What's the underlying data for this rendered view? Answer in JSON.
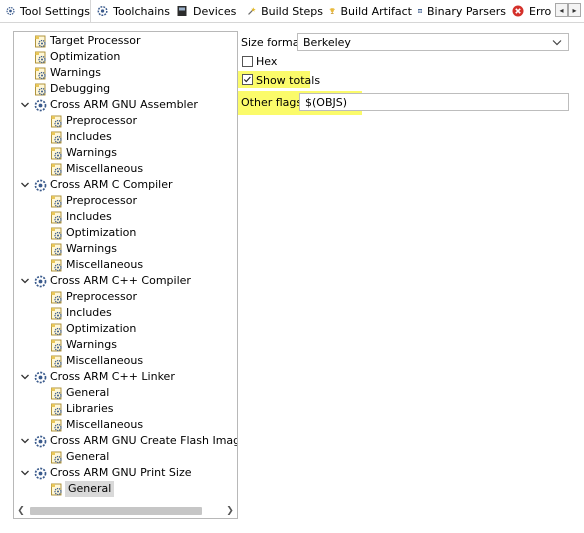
{
  "tabs": [
    {
      "label": "Tool Settings",
      "icon": "gear-settings-icon",
      "active": true
    },
    {
      "label": "Toolchains",
      "icon": "gear-settings-icon"
    },
    {
      "label": "Devices",
      "icon": "device-chip-icon"
    },
    {
      "label": "Build Steps",
      "icon": "build-wand-icon"
    },
    {
      "label": "Build Artifact",
      "icon": "artifact-trophy-icon"
    },
    {
      "label": "Binary Parsers",
      "icon": "binary-parser-icon"
    },
    {
      "label": "Erro",
      "icon": "error-icon"
    }
  ],
  "tree": [
    {
      "label": "Target Processor",
      "level": 1,
      "icon": "settings-page-icon"
    },
    {
      "label": "Optimization",
      "level": 1,
      "icon": "settings-page-icon"
    },
    {
      "label": "Warnings",
      "level": 1,
      "icon": "settings-page-icon"
    },
    {
      "label": "Debugging",
      "level": 1,
      "icon": "settings-page-icon"
    },
    {
      "label": "Cross ARM GNU Assembler",
      "level": 1,
      "icon": "tool-gear-icon",
      "expanded": true
    },
    {
      "label": "Preprocessor",
      "level": 2,
      "icon": "settings-page-icon"
    },
    {
      "label": "Includes",
      "level": 2,
      "icon": "settings-page-icon"
    },
    {
      "label": "Warnings",
      "level": 2,
      "icon": "settings-page-icon"
    },
    {
      "label": "Miscellaneous",
      "level": 2,
      "icon": "settings-page-icon"
    },
    {
      "label": "Cross ARM C Compiler",
      "level": 1,
      "icon": "tool-gear-icon",
      "expanded": true
    },
    {
      "label": "Preprocessor",
      "level": 2,
      "icon": "settings-page-icon"
    },
    {
      "label": "Includes",
      "level": 2,
      "icon": "settings-page-icon"
    },
    {
      "label": "Optimization",
      "level": 2,
      "icon": "settings-page-icon"
    },
    {
      "label": "Warnings",
      "level": 2,
      "icon": "settings-page-icon"
    },
    {
      "label": "Miscellaneous",
      "level": 2,
      "icon": "settings-page-icon"
    },
    {
      "label": "Cross ARM C++ Compiler",
      "level": 1,
      "icon": "tool-gear-icon",
      "expanded": true
    },
    {
      "label": "Preprocessor",
      "level": 2,
      "icon": "settings-page-icon"
    },
    {
      "label": "Includes",
      "level": 2,
      "icon": "settings-page-icon"
    },
    {
      "label": "Optimization",
      "level": 2,
      "icon": "settings-page-icon"
    },
    {
      "label": "Warnings",
      "level": 2,
      "icon": "settings-page-icon"
    },
    {
      "label": "Miscellaneous",
      "level": 2,
      "icon": "settings-page-icon"
    },
    {
      "label": "Cross ARM C++ Linker",
      "level": 1,
      "icon": "tool-gear-icon",
      "expanded": true
    },
    {
      "label": "General",
      "level": 2,
      "icon": "settings-page-icon"
    },
    {
      "label": "Libraries",
      "level": 2,
      "icon": "settings-page-icon"
    },
    {
      "label": "Miscellaneous",
      "level": 2,
      "icon": "settings-page-icon"
    },
    {
      "label": "Cross ARM GNU Create Flash Image",
      "level": 1,
      "icon": "tool-gear-icon",
      "expanded": true
    },
    {
      "label": "General",
      "level": 2,
      "icon": "settings-page-icon"
    },
    {
      "label": "Cross ARM GNU Print Size",
      "level": 1,
      "icon": "tool-gear-icon",
      "expanded": true
    },
    {
      "label": "General",
      "level": 2,
      "icon": "settings-page-icon",
      "selected": true
    }
  ],
  "settings": {
    "size_format_label": "Size format",
    "size_format_value": "Berkeley",
    "hex_label": "Hex",
    "hex_checked": false,
    "show_totals_label": "Show totals",
    "show_totals_checked": true,
    "other_flags_label": "Other flags",
    "other_flags_value": "$(OBJS)"
  },
  "colors": {
    "highlight": "#fbfb6a",
    "selection": "#d9d9d9",
    "border": "#bdbdbd"
  }
}
